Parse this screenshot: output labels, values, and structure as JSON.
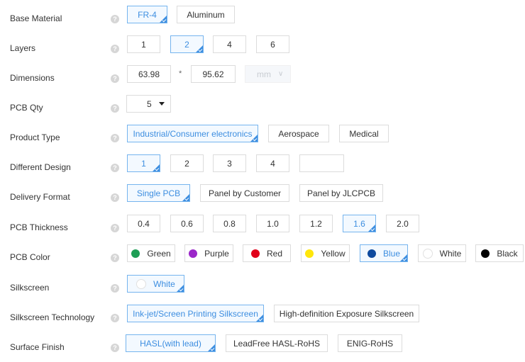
{
  "help_glyph": "?",
  "rows": {
    "base_material": {
      "label": "Base Material",
      "options": [
        "FR-4",
        "Aluminum"
      ],
      "selected": "FR-4"
    },
    "layers": {
      "label": "Layers",
      "options": [
        "1",
        "2",
        "4",
        "6"
      ],
      "selected": "2"
    },
    "dimensions": {
      "label": "Dimensions",
      "width": "63.98",
      "times": "*",
      "height": "95.62",
      "unit": "mm"
    },
    "pcb_qty": {
      "label": "PCB Qty",
      "value": "5"
    },
    "product_type": {
      "label": "Product Type",
      "options": [
        "Industrial/Consumer electronics",
        "Aerospace",
        "Medical"
      ],
      "selected": "Industrial/Consumer electronics"
    },
    "different_design": {
      "label": "Different Design",
      "options": [
        "1",
        "2",
        "3",
        "4",
        ""
      ],
      "selected": "1"
    },
    "delivery_format": {
      "label": "Delivery Format",
      "options": [
        "Single PCB",
        "Panel by Customer",
        "Panel by JLCPCB"
      ],
      "selected": "Single PCB"
    },
    "pcb_thickness": {
      "label": "PCB Thickness",
      "options": [
        "0.4",
        "0.6",
        "0.8",
        "1.0",
        "1.2",
        "1.6",
        "2.0"
      ],
      "selected": "1.6"
    },
    "pcb_color": {
      "label": "PCB Color",
      "options": [
        {
          "name": "Green",
          "color": "#1e9e55"
        },
        {
          "name": "Purple",
          "color": "#9b27c9"
        },
        {
          "name": "Red",
          "color": "#e1001a"
        },
        {
          "name": "Yellow",
          "color": "#ffe60a"
        },
        {
          "name": "Blue",
          "color": "#0e4a9e"
        },
        {
          "name": "White",
          "color": "#ffffff"
        },
        {
          "name": "Black",
          "color": "#000000"
        }
      ],
      "selected": "Blue"
    },
    "silkscreen": {
      "label": "Silkscreen",
      "options": [
        {
          "name": "White",
          "color": "#ffffff"
        }
      ],
      "selected": "White"
    },
    "silkscreen_technology": {
      "label": "Silkscreen Technology",
      "options": [
        "Ink-jet/Screen Printing Silkscreen",
        "High-definition Exposure Silkscreen"
      ],
      "selected": "Ink-jet/Screen Printing Silkscreen"
    },
    "surface_finish": {
      "label": "Surface Finish",
      "options": [
        "HASL(with lead)",
        "LeadFree HASL-RoHS",
        "ENIG-RoHS"
      ],
      "selected": "HASL(with lead)"
    }
  }
}
